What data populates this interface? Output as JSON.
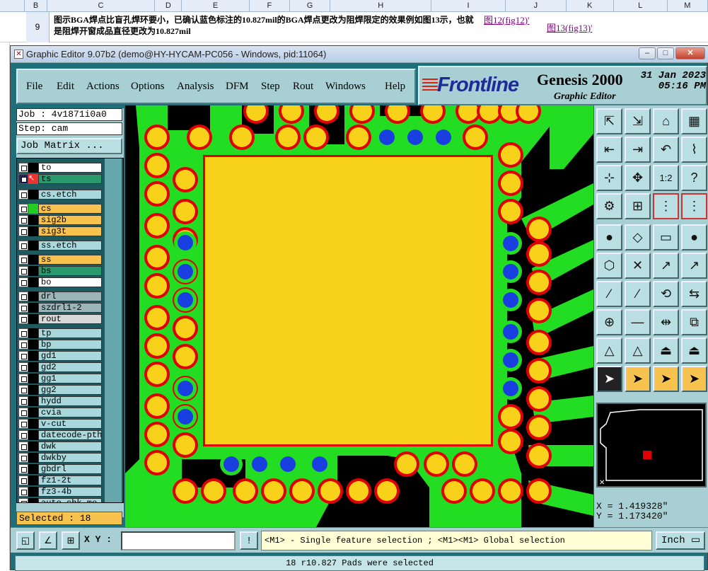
{
  "excel": {
    "columns": [
      "B",
      "C",
      "D",
      "E",
      "F",
      "G",
      "H",
      "I",
      "J",
      "K",
      "L",
      "M"
    ],
    "row_number": "9",
    "cell_text": "图示BGA焊点比盲孔焊环要小，已确认蓝色标注的10.827mil的BGA焊点更改为阻焊限定的效果例如图13示，也就是阻焊开窗成品直径更改为10.827mil",
    "link_j": "图12(fig12)'",
    "link_k": "图13(fig13)'"
  },
  "window": {
    "title": "Graphic Editor 9.07b2 (demo@HY-HYCAM-PC056 - Windows, pid:11064)",
    "icon": "genesis-app-icon"
  },
  "menu": [
    "File",
    "Edit",
    "Actions",
    "Options",
    "Analysis",
    "DFM",
    "Step",
    "Rout",
    "Windows",
    "Help"
  ],
  "brand": {
    "logo": "Frontline",
    "product": "Genesis 2000",
    "subtitle": "Graphic Editor",
    "date": "31 Jan 2023",
    "time": "05:16 PM"
  },
  "job": {
    "job_label": "Job : 4v1871i0a0",
    "step_label": "Step: cam",
    "matrix_button": "Job Matrix ..."
  },
  "layers": [
    {
      "name": "to",
      "color": "#ffffff"
    },
    {
      "name": "ts",
      "color": "#2a9a6e",
      "active": true
    },
    {
      "name": "cs.etch",
      "color": "#a8d8dc"
    },
    {
      "name": "cs",
      "color": "#f8c24f",
      "shown": true
    },
    {
      "name": "sig2b",
      "color": "#f8c24f"
    },
    {
      "name": "sig3t",
      "color": "#f8c24f"
    },
    {
      "name": "ss.etch",
      "color": "#a8d8dc"
    },
    {
      "name": "ss",
      "color": "#f8c24f"
    },
    {
      "name": "bs",
      "color": "#2a9a6e"
    },
    {
      "name": "bo",
      "color": "#ffffff"
    },
    {
      "name": "drl",
      "color": "#9ab4b8"
    },
    {
      "name": "szdrl1-2",
      "color": "#9ab4b8"
    },
    {
      "name": "rout",
      "color": "#d8d8d8"
    },
    {
      "name": "tp",
      "color": "#a8d8dc"
    },
    {
      "name": "bp",
      "color": "#a8d8dc"
    },
    {
      "name": "gd1",
      "color": "#a8d8dc"
    },
    {
      "name": "gd2",
      "color": "#a8d8dc"
    },
    {
      "name": "gg1",
      "color": "#a8d8dc"
    },
    {
      "name": "gg2",
      "color": "#a8d8dc"
    },
    {
      "name": "hydd",
      "color": "#a8d8dc"
    },
    {
      "name": "cvia",
      "color": "#a8d8dc"
    },
    {
      "name": "v-cut",
      "color": "#a8d8dc"
    },
    {
      "name": "datecode-pth",
      "color": "#a8d8dc"
    },
    {
      "name": "dwk",
      "color": "#a8d8dc"
    },
    {
      "name": "dwkby",
      "color": "#a8d8dc"
    },
    {
      "name": "gbdrl",
      "color": "#a8d8dc"
    },
    {
      "name": "fz1-2t",
      "color": "#a8d8dc"
    },
    {
      "name": "fz3-4b",
      "color": "#a8d8dc"
    },
    {
      "name": "auto_chk_mo",
      "color": "#a8d8dc"
    }
  ],
  "selected_label": "Selected : 18",
  "coords": {
    "x": "X = 1.419328\"",
    "y": "Y = 1.173420\""
  },
  "bottom": {
    "xy_label": "X Y :",
    "xy_value": "",
    "hint": "<M1> - Single feature selection ; <M1><M1> Global selection",
    "unit": "Inch",
    "status": "18 r10.827 Pads were selected"
  },
  "colors": {
    "board_green": "#22dd22",
    "pad_yellow": "#f8d21a",
    "ring_red": "#ee0000",
    "via_blue": "#1a3fe0",
    "ui_teal": "#a8cfd3"
  },
  "toolbar_icons": [
    "fit-icon",
    "zoom-in-icon",
    "home-icon",
    "grid-icon",
    "pan-left-icon",
    "pan-right-icon",
    "undo-icon",
    "snap-icon",
    "center-icon",
    "zoom-fit-icon",
    "ratio-icon",
    "help-icon",
    "measure-tool-icon",
    "grid-view-icon",
    "layer-compare-icon",
    "layer-compare2-icon",
    "pad-add-icon",
    "line-add-icon",
    "ruler-icon",
    "dot-icon",
    "connect-icon",
    "delete-icon",
    "move-icon",
    "copy-icon",
    "line-tool-icon",
    "line-tool2-icon",
    "arc-tool-icon",
    "mirror-icon",
    "pad-move-icon",
    "cut-icon",
    "stretch-icon",
    "resize-icon",
    "triangle-icon",
    "triangle2-icon",
    "polygon-icon",
    "polygon2-icon",
    "select-icon",
    "select-box-icon",
    "select-lasso-icon",
    "select-net-icon"
  ]
}
